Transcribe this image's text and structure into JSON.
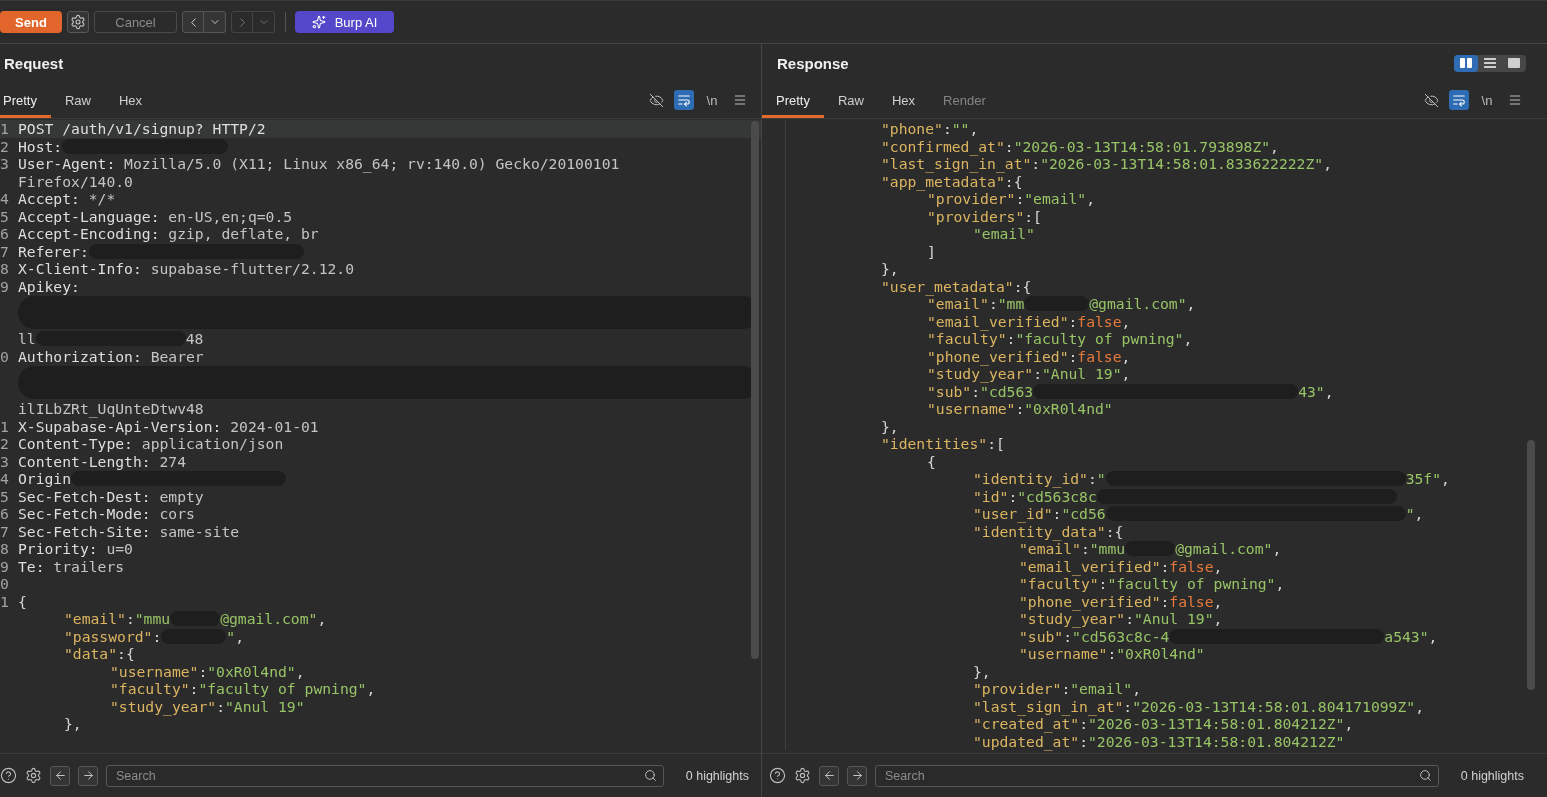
{
  "toolbar": {
    "buttons": [
      {
        "kind": "send",
        "label": "Send",
        "disabled": false
      },
      {
        "kind": "settings",
        "disabled": false
      },
      {
        "kind": "cancel",
        "label": "Cancel",
        "disabled": true
      },
      {
        "kind": "back",
        "disabled": false
      },
      {
        "kind": "forward",
        "disabled": true
      },
      {
        "kind": "ai",
        "label": "Burp AI",
        "disabled": false
      }
    ]
  },
  "request": {
    "title": "Request",
    "tabs": [
      {
        "label": "Pretty",
        "selected": true
      },
      {
        "label": "Raw",
        "selected": false
      },
      {
        "label": "Hex",
        "selected": false
      }
    ],
    "toggles": [
      {
        "kind": "hidden-chars",
        "on": false
      },
      {
        "kind": "wrap",
        "on": true
      },
      {
        "kind": "newline",
        "label": "\\n",
        "on": false
      },
      {
        "kind": "menu"
      }
    ],
    "lines": [
      {
        "n": "1",
        "current": true,
        "segs": [
          {
            "kind": "name",
            "t": "POST /auth/v1/signup? HTTP/2"
          }
        ]
      },
      {
        "n": "2",
        "current": false,
        "segs": [
          {
            "kind": "name",
            "t": "Host:"
          },
          {
            "kind": "stroke"
          }
        ]
      },
      {
        "n": "3",
        "current": false,
        "segs": [
          {
            "kind": "name",
            "t": "User-Agent:"
          },
          {
            "kind": "val",
            "t": " Mozilla/5.0 (X11; Linux x86_64; rv:140.0) Gecko/20100101"
          }
        ]
      },
      {
        "current": false,
        "segs": [
          {
            "kind": "val",
            "t": "Firefox/140.0"
          }
        ]
      },
      {
        "n": "4",
        "current": false,
        "segs": [
          {
            "kind": "name",
            "t": "Accept:"
          },
          {
            "kind": "val",
            "t": " */*"
          }
        ]
      },
      {
        "n": "5",
        "current": false,
        "segs": [
          {
            "kind": "name",
            "t": "Accept-Language:"
          },
          {
            "kind": "val",
            "t": " en-US,en;q=0.5"
          }
        ]
      },
      {
        "n": "6",
        "current": false,
        "segs": [
          {
            "kind": "name",
            "t": "Accept-Encoding:"
          },
          {
            "kind": "val",
            "t": " gzip, deflate, br"
          }
        ]
      },
      {
        "n": "7",
        "current": false,
        "segs": [
          {
            "kind": "name",
            "t": "Referer:"
          },
          {
            "kind": "swath"
          }
        ]
      },
      {
        "n": "8",
        "current": false,
        "segs": [
          {
            "kind": "name",
            "t": "X-Client-Info:"
          },
          {
            "kind": "val",
            "t": " supabase-flutter/2.12.0"
          }
        ]
      },
      {
        "n": "9",
        "current": false,
        "segs": [
          {
            "kind": "name",
            "t": "Apikey:"
          }
        ]
      },
      {
        "current": false,
        "segs": [
          {
            "kind": "block"
          }
        ]
      },
      {
        "current": false,
        "segs": [
          {
            "kind": "val",
            "t": "ll"
          },
          {
            "kind": "streak"
          },
          {
            "kind": "val",
            "t": "48"
          }
        ]
      },
      {
        "n": "0",
        "current": false,
        "segs": [
          {
            "kind": "name",
            "t": "Authorization:"
          },
          {
            "kind": "val",
            "t": " Bearer"
          }
        ]
      },
      {
        "current": false,
        "segs": [
          {
            "kind": "block"
          }
        ]
      },
      {
        "current": false,
        "segs": [
          {
            "kind": "val",
            "t": "ilILbZRt_UqUnteDtwv48"
          }
        ]
      },
      {
        "n": "1",
        "current": false,
        "segs": [
          {
            "kind": "name",
            "t": "X-Supabase-Api-Version:"
          },
          {
            "kind": "val",
            "t": " 2024-01-01"
          }
        ]
      },
      {
        "n": "2",
        "current": false,
        "segs": [
          {
            "kind": "name",
            "t": "Content-Type:"
          },
          {
            "kind": "val",
            "t": " application/json"
          }
        ]
      },
      {
        "n": "3",
        "current": false,
        "segs": [
          {
            "kind": "name",
            "t": "Content-Length:"
          },
          {
            "kind": "val",
            "t": " 274"
          }
        ]
      },
      {
        "n": "4",
        "current": false,
        "segs": [
          {
            "kind": "name",
            "t": "Origin"
          },
          {
            "kind": "swath"
          }
        ]
      },
      {
        "n": "5",
        "current": false,
        "segs": [
          {
            "kind": "name",
            "t": "Sec-Fetch-Dest:"
          },
          {
            "kind": "val",
            "t": " empty"
          }
        ]
      },
      {
        "n": "6",
        "current": false,
        "segs": [
          {
            "kind": "name",
            "t": "Sec-Fetch-Mode:"
          },
          {
            "kind": "val",
            "t": " cors"
          }
        ]
      },
      {
        "n": "7",
        "current": false,
        "segs": [
          {
            "kind": "name",
            "t": "Sec-Fetch-Site:"
          },
          {
            "kind": "val",
            "t": " same-site"
          }
        ]
      },
      {
        "n": "8",
        "current": false,
        "segs": [
          {
            "kind": "name",
            "t": "Priority:"
          },
          {
            "kind": "val",
            "t": " u=0"
          }
        ]
      },
      {
        "n": "9",
        "current": false,
        "segs": [
          {
            "kind": "name",
            "t": "Te:"
          },
          {
            "kind": "val",
            "t": " trailers"
          }
        ]
      },
      {
        "n": "0",
        "current": false
      },
      {
        "n": "1",
        "current": false,
        "segs": [
          {
            "kind": "punct",
            "t": "{"
          }
        ],
        "children": [
          {
            "current": false,
            "segs": [
              {
                "kind": "key",
                "t": "\"email\""
              },
              {
                "kind": "punct",
                "t": ":"
              },
              {
                "kind": "str",
                "t": "\"mmu"
              },
              {
                "kind": "smudge"
              },
              {
                "kind": "str",
                "t": "@gmail.com\""
              },
              {
                "kind": "punct",
                "t": ","
              }
            ]
          },
          {
            "current": false,
            "segs": [
              {
                "kind": "key",
                "t": "\"password\""
              },
              {
                "kind": "punct",
                "t": ":"
              },
              {
                "kind": "blot"
              },
              {
                "kind": "str",
                "t": "\""
              },
              {
                "kind": "punct",
                "t": ","
              }
            ]
          },
          {
            "current": false,
            "segs": [
              {
                "kind": "key",
                "t": "\"data\""
              },
              {
                "kind": "punct",
                "t": ":{"
              }
            ],
            "children": [
              {
                "current": false,
                "segs": [
                  {
                    "kind": "key",
                    "t": "\"username\""
                  },
                  {
                    "kind": "punct",
                    "t": ":"
                  },
                  {
                    "kind": "str",
                    "t": "\"0xR0l4nd\""
                  },
                  {
                    "kind": "punct",
                    "t": ","
                  }
                ]
              },
              {
                "current": false,
                "segs": [
                  {
                    "kind": "key",
                    "t": "\"faculty\""
                  },
                  {
                    "kind": "punct",
                    "t": ":"
                  },
                  {
                    "kind": "str",
                    "t": "\"faculty of pwning\""
                  },
                  {
                    "kind": "punct",
                    "t": ","
                  }
                ]
              },
              {
                "current": false,
                "segs": [
                  {
                    "kind": "key",
                    "t": "\"study_year\""
                  },
                  {
                    "kind": "punct",
                    "t": ":"
                  },
                  {
                    "kind": "str",
                    "t": "\"Anul 19\""
                  }
                ]
              }
            ]
          },
          {
            "current": false,
            "segs": [
              {
                "kind": "punct",
                "t": "},"
              }
            ]
          }
        ]
      }
    ],
    "footer": {
      "search": {
        "placeholder": "Search"
      },
      "highlights": "0 highlights"
    }
  },
  "response": {
    "title": "Response",
    "layouts": [
      {
        "kind": "columns",
        "selected": true
      },
      {
        "kind": "rows",
        "selected": false
      },
      {
        "kind": "single",
        "selected": false
      }
    ],
    "tabs": [
      {
        "label": "Pretty",
        "selected": true,
        "disabled": false
      },
      {
        "label": "Raw",
        "selected": false,
        "disabled": false
      },
      {
        "label": "Hex",
        "selected": false,
        "disabled": false
      },
      {
        "label": "Render",
        "selected": false,
        "disabled": true
      }
    ],
    "toggles": [
      {
        "kind": "hidden-chars",
        "on": false
      },
      {
        "kind": "wrap",
        "on": true
      },
      {
        "kind": "newline",
        "label": "\\n",
        "on": false
      },
      {
        "kind": "menu"
      }
    ],
    "lines": [
      {
        "segs": [
          {
            "kind": "key",
            "t": "\"phone\""
          },
          {
            "kind": "punct",
            "t": ":"
          },
          {
            "kind": "str",
            "t": "\"\""
          },
          {
            "kind": "punct",
            "t": ","
          }
        ]
      },
      {
        "segs": [
          {
            "kind": "key",
            "t": "\"confirmed_at\""
          },
          {
            "kind": "punct",
            "t": ":"
          },
          {
            "kind": "str",
            "t": "\"2026-03-13T14:58:01.793898Z\""
          },
          {
            "kind": "punct",
            "t": ","
          }
        ]
      },
      {
        "segs": [
          {
            "kind": "key",
            "t": "\"last_sign_in_at\""
          },
          {
            "kind": "punct",
            "t": ":"
          },
          {
            "kind": "str",
            "t": "\"2026-03-13T14:58:01.833622222Z\""
          },
          {
            "kind": "punct",
            "t": ","
          }
        ]
      },
      {
        "segs": [
          {
            "kind": "key",
            "t": "\"app_metadata\""
          },
          {
            "kind": "punct",
            "t": ":{"
          }
        ],
        "children": [
          {
            "segs": [
              {
                "kind": "key",
                "t": "\"provider\""
              },
              {
                "kind": "punct",
                "t": ":"
              },
              {
                "kind": "str",
                "t": "\"email\""
              },
              {
                "kind": "punct",
                "t": ","
              }
            ]
          },
          {
            "segs": [
              {
                "kind": "key",
                "t": "\"providers\""
              },
              {
                "kind": "punct",
                "t": ":["
              }
            ],
            "children": [
              {
                "segs": [
                  {
                    "kind": "str",
                    "t": "\"email\""
                  }
                ]
              }
            ]
          },
          {
            "segs": [
              {
                "kind": "punct",
                "t": "]"
              }
            ]
          }
        ]
      },
      {
        "segs": [
          {
            "kind": "punct",
            "t": "},"
          }
        ]
      },
      {
        "segs": [
          {
            "kind": "key",
            "t": "\"user_metadata\""
          },
          {
            "kind": "punct",
            "t": ":{"
          }
        ],
        "children": [
          {
            "segs": [
              {
                "kind": "key",
                "t": "\"email\""
              },
              {
                "kind": "punct",
                "t": ":"
              },
              {
                "kind": "str",
                "t": "\"mm"
              },
              {
                "kind": "blot"
              },
              {
                "kind": "str",
                "t": "@gmail.com\""
              },
              {
                "kind": "punct",
                "t": ","
              }
            ]
          },
          {
            "segs": [
              {
                "kind": "key",
                "t": "\"email_verified\""
              },
              {
                "kind": "punct",
                "t": ":"
              },
              {
                "kind": "bool",
                "t": "false"
              },
              {
                "kind": "punct",
                "t": ","
              }
            ]
          },
          {
            "segs": [
              {
                "kind": "key",
                "t": "\"faculty\""
              },
              {
                "kind": "punct",
                "t": ":"
              },
              {
                "kind": "str",
                "t": "\"faculty of pwning\""
              },
              {
                "kind": "punct",
                "t": ","
              }
            ]
          },
          {
            "segs": [
              {
                "kind": "key",
                "t": "\"phone_verified\""
              },
              {
                "kind": "punct",
                "t": ":"
              },
              {
                "kind": "bool",
                "t": "false"
              },
              {
                "kind": "punct",
                "t": ","
              }
            ]
          },
          {
            "segs": [
              {
                "kind": "key",
                "t": "\"study_year\""
              },
              {
                "kind": "punct",
                "t": ":"
              },
              {
                "kind": "str",
                "t": "\"Anul 19\""
              },
              {
                "kind": "punct",
                "t": ","
              }
            ]
          },
          {
            "segs": [
              {
                "kind": "key",
                "t": "\"sub\""
              },
              {
                "kind": "punct",
                "t": ":"
              },
              {
                "kind": "str",
                "t": "\"cd563"
              },
              {
                "kind": "band"
              },
              {
                "kind": "str",
                "t": "43\""
              },
              {
                "kind": "punct",
                "t": ","
              }
            ]
          },
          {
            "segs": [
              {
                "kind": "key",
                "t": "\"username\""
              },
              {
                "kind": "punct",
                "t": ":"
              },
              {
                "kind": "str",
                "t": "\"0xR0l4nd\""
              }
            ]
          }
        ]
      },
      {
        "segs": [
          {
            "kind": "punct",
            "t": "},"
          }
        ]
      },
      {
        "segs": [
          {
            "kind": "key",
            "t": "\"identities\""
          },
          {
            "kind": "punct",
            "t": ":["
          }
        ],
        "children": [
          {
            "segs": [
              {
                "kind": "punct",
                "t": "{"
              }
            ],
            "children": [
              {
                "segs": [
                  {
                    "kind": "key",
                    "t": "\"identity_id\""
                  },
                  {
                    "kind": "punct",
                    "t": ":"
                  },
                  {
                    "kind": "str",
                    "t": "\""
                  },
                  {
                    "kind": "slab"
                  },
                  {
                    "kind": "str",
                    "t": "35f\""
                  },
                  {
                    "kind": "punct",
                    "t": ","
                  }
                ]
              },
              {
                "segs": [
                  {
                    "kind": "key",
                    "t": "\"id\""
                  },
                  {
                    "kind": "punct",
                    "t": ":"
                  },
                  {
                    "kind": "str",
                    "t": "\"cd563c8c"
                  },
                  {
                    "kind": "slab"
                  }
                ]
              },
              {
                "segs": [
                  {
                    "kind": "key",
                    "t": "\"user_id\""
                  },
                  {
                    "kind": "punct",
                    "t": ":"
                  },
                  {
                    "kind": "str",
                    "t": "\"cd56"
                  },
                  {
                    "kind": "slab"
                  },
                  {
                    "kind": "str",
                    "t": "\""
                  },
                  {
                    "kind": "punct",
                    "t": ","
                  }
                ]
              },
              {
                "segs": [
                  {
                    "kind": "key",
                    "t": "\"identity_data\""
                  },
                  {
                    "kind": "punct",
                    "t": ":{"
                  }
                ],
                "children": [
                  {
                    "segs": [
                      {
                        "kind": "key",
                        "t": "\"email\""
                      },
                      {
                        "kind": "punct",
                        "t": ":"
                      },
                      {
                        "kind": "str",
                        "t": "\"mmu"
                      },
                      {
                        "kind": "smudge"
                      },
                      {
                        "kind": "str",
                        "t": "@gmail.com\""
                      },
                      {
                        "kind": "punct",
                        "t": ","
                      }
                    ]
                  },
                  {
                    "segs": [
                      {
                        "kind": "key",
                        "t": "\"email_verified\""
                      },
                      {
                        "kind": "punct",
                        "t": ":"
                      },
                      {
                        "kind": "bool",
                        "t": "false"
                      },
                      {
                        "kind": "punct",
                        "t": ","
                      }
                    ]
                  },
                  {
                    "segs": [
                      {
                        "kind": "key",
                        "t": "\"faculty\""
                      },
                      {
                        "kind": "punct",
                        "t": ":"
                      },
                      {
                        "kind": "str",
                        "t": "\"faculty of pwning\""
                      },
                      {
                        "kind": "punct",
                        "t": ","
                      }
                    ]
                  },
                  {
                    "segs": [
                      {
                        "kind": "key",
                        "t": "\"phone_verified\""
                      },
                      {
                        "kind": "punct",
                        "t": ":"
                      },
                      {
                        "kind": "bool",
                        "t": "false"
                      },
                      {
                        "kind": "punct",
                        "t": ","
                      }
                    ]
                  },
                  {
                    "segs": [
                      {
                        "kind": "key",
                        "t": "\"study_year\""
                      },
                      {
                        "kind": "punct",
                        "t": ":"
                      },
                      {
                        "kind": "str",
                        "t": "\"Anul 19\""
                      },
                      {
                        "kind": "punct",
                        "t": ","
                      }
                    ]
                  },
                  {
                    "segs": [
                      {
                        "kind": "key",
                        "t": "\"sub\""
                      },
                      {
                        "kind": "punct",
                        "t": ":"
                      },
                      {
                        "kind": "str",
                        "t": "\"cd563c8c-4"
                      },
                      {
                        "kind": "swath"
                      },
                      {
                        "kind": "str",
                        "t": "a543\""
                      },
                      {
                        "kind": "punct",
                        "t": ","
                      }
                    ]
                  },
                  {
                    "segs": [
                      {
                        "kind": "key",
                        "t": "\"username\""
                      },
                      {
                        "kind": "punct",
                        "t": ":"
                      },
                      {
                        "kind": "str",
                        "t": "\"0xR0l4nd\""
                      }
                    ]
                  }
                ]
              },
              {
                "segs": [
                  {
                    "kind": "punct",
                    "t": "},"
                  }
                ]
              },
              {
                "segs": [
                  {
                    "kind": "key",
                    "t": "\"provider\""
                  },
                  {
                    "kind": "punct",
                    "t": ":"
                  },
                  {
                    "kind": "str",
                    "t": "\"email\""
                  },
                  {
                    "kind": "punct",
                    "t": ","
                  }
                ]
              },
              {
                "segs": [
                  {
                    "kind": "key",
                    "t": "\"last_sign_in_at\""
                  },
                  {
                    "kind": "punct",
                    "t": ":"
                  },
                  {
                    "kind": "str",
                    "t": "\"2026-03-13T14:58:01.804171099Z\""
                  },
                  {
                    "kind": "punct",
                    "t": ","
                  }
                ]
              },
              {
                "segs": [
                  {
                    "kind": "key",
                    "t": "\"created_at\""
                  },
                  {
                    "kind": "punct",
                    "t": ":"
                  },
                  {
                    "kind": "str",
                    "t": "\"2026-03-13T14:58:01.804212Z\""
                  },
                  {
                    "kind": "punct",
                    "t": ","
                  }
                ]
              },
              {
                "segs": [
                  {
                    "kind": "key",
                    "t": "\"updated_at\""
                  },
                  {
                    "kind": "punct",
                    "t": ":"
                  },
                  {
                    "kind": "str",
                    "t": "\"2026-03-13T14:58:01.804212Z\""
                  }
                ]
              }
            ]
          }
        ]
      }
    ],
    "footer": {
      "search": {
        "placeholder": "Search"
      },
      "highlights": "0 highlights"
    }
  }
}
